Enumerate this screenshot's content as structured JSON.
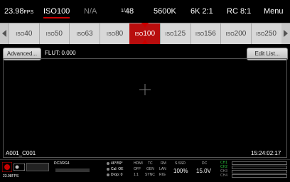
{
  "topbar": {
    "fps_value": "23.98",
    "fps_unit": "FPS",
    "iso": "ISO100",
    "na": "N/A",
    "shutter_prefix": "1/",
    "shutter_value": "48",
    "white_balance": "5600K",
    "resolution": "6K 2:1",
    "compression": "RC 8:1",
    "menu": "Menu"
  },
  "iso_strip": {
    "items": [
      {
        "prefix": "ISO",
        "value": "40"
      },
      {
        "prefix": "ISO",
        "value": "50"
      },
      {
        "prefix": "ISO",
        "value": "63"
      },
      {
        "prefix": "ISO",
        "value": "80"
      },
      {
        "prefix": "ISO",
        "value": "100"
      },
      {
        "prefix": "ISO",
        "value": "125"
      },
      {
        "prefix": "ISO",
        "value": "156"
      },
      {
        "prefix": "ISO",
        "value": "200"
      },
      {
        "prefix": "ISO",
        "value": "250"
      }
    ],
    "selected": "ISO100"
  },
  "main": {
    "advanced_label": "Advanced...",
    "flut_label": "FLUT: 0.000",
    "edit_list_label": "Edit List...",
    "clip_name": "A001_C001",
    "timecode": "15:24:02:17"
  },
  "bottombar": {
    "fps": "23.98FPS",
    "codec": "DC2/RG4",
    "angle": "46°/59°",
    "cal": "Cal: OE",
    "drop": "Drop: 0",
    "hdmi_label": "HDMI",
    "hdmi_value": "OFF",
    "tc_label": "TC",
    "tc_value": "GEN",
    "rm_label": "RM",
    "rm_value": "LAN",
    "r1": "1:1",
    "r2": "SYNC",
    "r3": "RIG",
    "ssd_label": "S.SSD",
    "ssd_value": "100%",
    "dc_label": "DC",
    "dc_value": "15.0V",
    "channels": [
      "CH1",
      "CH2",
      "CH3",
      "CH4"
    ],
    "accent_green": "#2ecc40",
    "accent_red": "#c80000"
  }
}
